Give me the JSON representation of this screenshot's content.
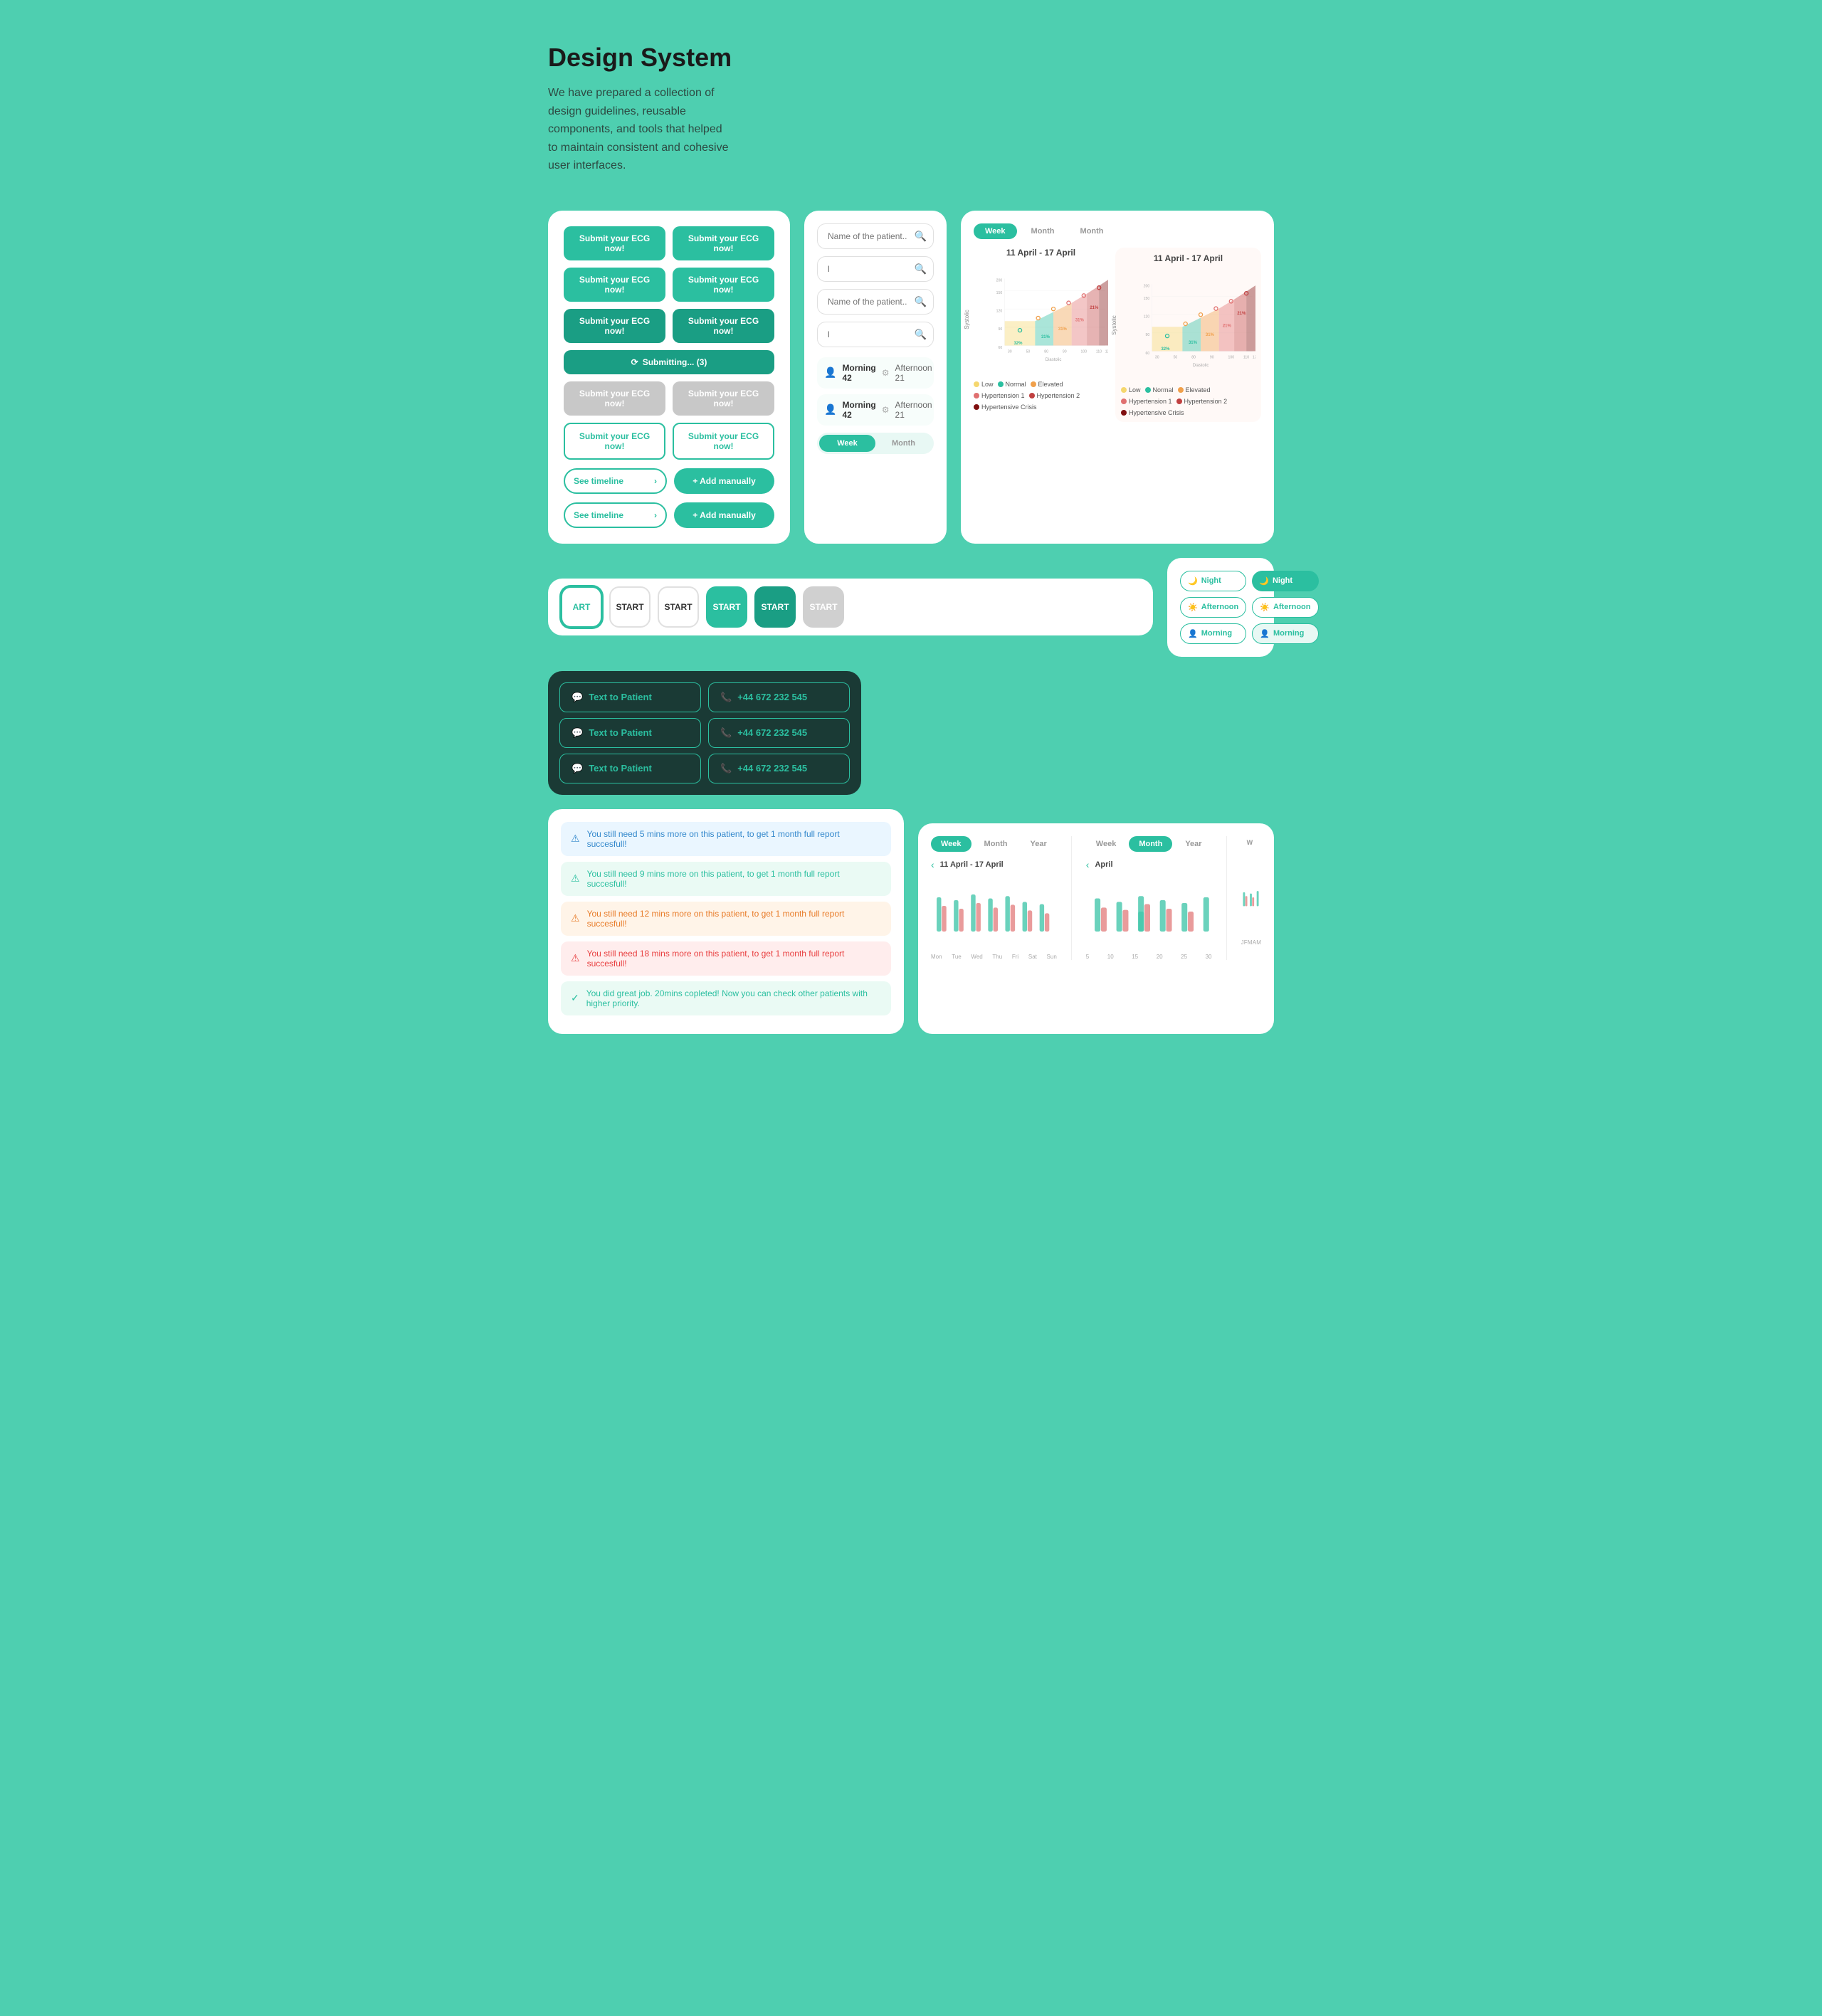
{
  "header": {
    "title": "Design System",
    "description": "We have prepared a collection of design guidelines, reusable components, and tools that helped to maintain consistent and cohesive user interfaces."
  },
  "buttons_panel": {
    "ecg_label": "Submit your ECG now!",
    "submitting_label": "Submitting... (3)",
    "timeline_label": "See timeline",
    "add_manually_label": "+ Add manually"
  },
  "search_panel": {
    "placeholder1": "Name of the patient...",
    "placeholder2": "Name of the patient...",
    "input_text1": "l",
    "input_text2": "l"
  },
  "dose_panel": {
    "morning1_label": "Morning 42",
    "afternoon1_label": "Afternoon 21",
    "morning2_label": "Morning 42",
    "afternoon2_label": "Afternoon 21"
  },
  "week_toggle": {
    "week_label": "Week",
    "month_label": "Month"
  },
  "chart_panel": {
    "tab_week": "Week",
    "tab_month": "Month",
    "date_range": "11 April - 17 April",
    "y_label": "Systolic",
    "x_label": "Diastolic",
    "legend": [
      {
        "label": "Low",
        "color": "#f5d76e"
      },
      {
        "label": "Normal",
        "color": "#2bbfa0"
      },
      {
        "label": "Elevated",
        "color": "#f0a04b"
      },
      {
        "label": "Hypertension 1",
        "color": "#e07070"
      },
      {
        "label": "Hypertension 2",
        "color": "#c04040"
      },
      {
        "label": "Hypertensive Crisis",
        "color": "#801010"
      }
    ],
    "percentages": [
      "32%",
      "31%",
      "31%",
      "31%",
      "21%"
    ]
  },
  "start_buttons": {
    "labels": [
      "ART",
      "START",
      "START",
      "START",
      "START",
      "START"
    ]
  },
  "tags_panel": {
    "night_label": "Night",
    "afternoon_label": "Afternoon",
    "morning_label": "Morning"
  },
  "text_patient_panel": {
    "text_to_patient_label": "Text to Patient",
    "phone_label": "+44 672 232 545"
  },
  "alerts": [
    {
      "type": "blue",
      "text": "You still need 5 mins more on this patient, to get 1 month full report succesfull!"
    },
    {
      "type": "green",
      "text": "You still need 9 mins more on this patient, to get 1 month full report succesfull!"
    },
    {
      "type": "orange",
      "text": "You still need 12 mins more on this patient, to get 1 month full report succesfull!"
    },
    {
      "type": "red",
      "text": "You still need 18 mins more on this patient, to get 1 month full report succesfull!"
    },
    {
      "type": "success",
      "text": "You did great job. 20mins copleted! Now you can check other patients with higher priority."
    }
  ],
  "bottom_charts": {
    "tab_week": "Week",
    "tab_month": "Month",
    "tab_year": "Year",
    "date_range_week": "11 April - 17 April",
    "date_range_month": "April",
    "x_labels_week": [
      "Mon",
      "Tue",
      "Wed",
      "Thu",
      "Fri",
      "Sat",
      "Sun"
    ],
    "x_labels_month": [
      "5",
      "10",
      "15",
      "20",
      "25",
      "30"
    ],
    "x_labels_year": [
      "J",
      "F",
      "M",
      "A",
      "M"
    ]
  }
}
